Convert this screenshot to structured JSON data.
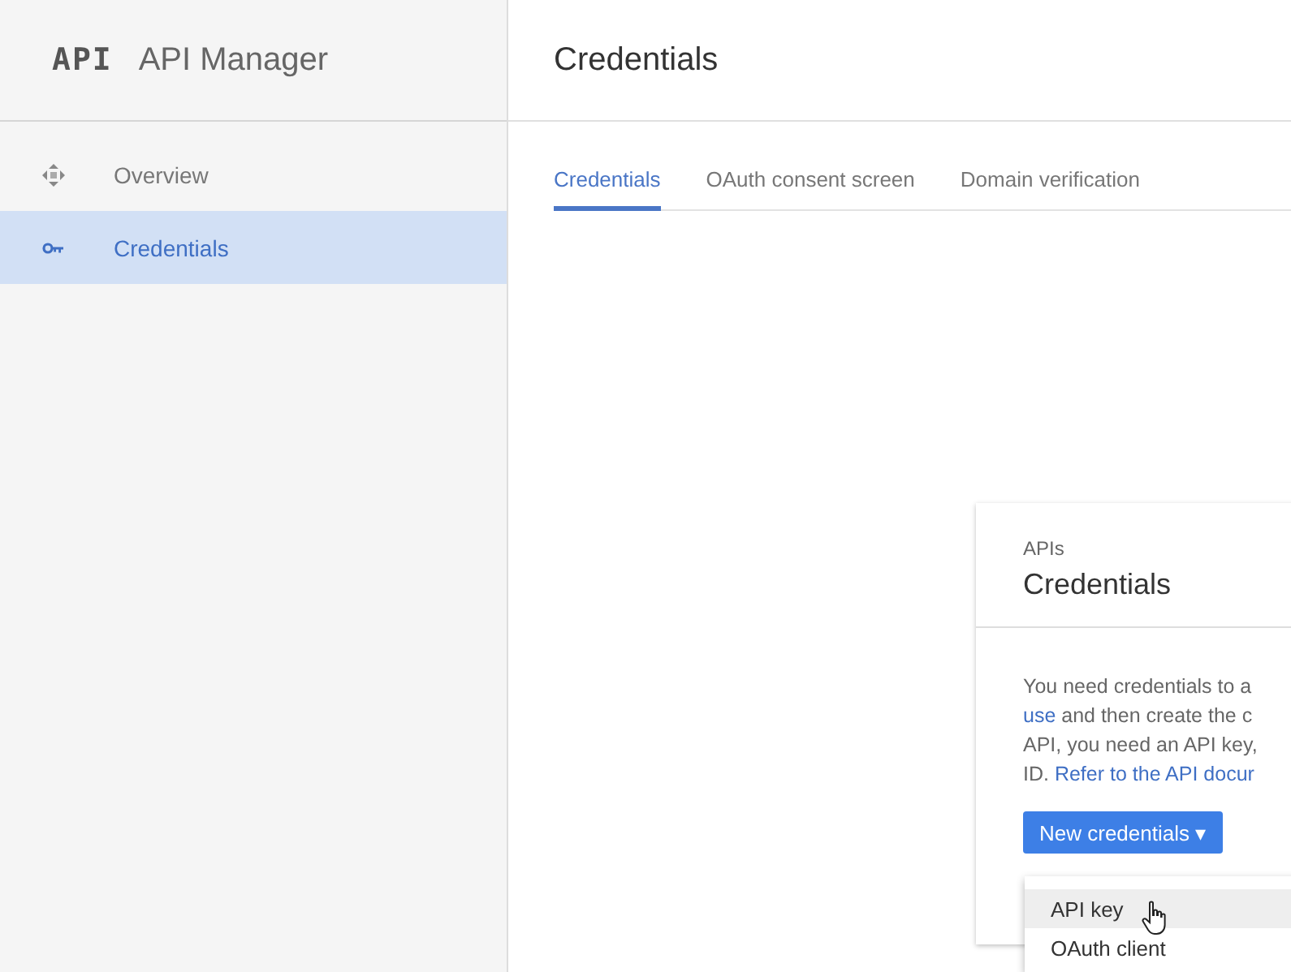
{
  "sidebar": {
    "logo": "API",
    "title": "API Manager",
    "items": [
      {
        "label": "Overview",
        "kind": "overview",
        "selected": false
      },
      {
        "label": "Credentials",
        "kind": "key",
        "selected": true
      }
    ]
  },
  "main": {
    "title": "Credentials",
    "tabs": [
      {
        "label": "Credentials",
        "selected": true
      },
      {
        "label": "OAuth consent screen",
        "selected": false
      },
      {
        "label": "Domain verification",
        "selected": false
      }
    ]
  },
  "card": {
    "overline": "APIs",
    "title": "Credentials",
    "lines": [
      [
        {
          "text": "You need credentials to a",
          "link": false
        }
      ],
      [
        {
          "text": "use",
          "link": true
        },
        {
          "text": " and then create the c",
          "link": false
        }
      ],
      [
        {
          "text": "API, you need an API key,",
          "link": false
        }
      ],
      [
        {
          "text": "ID. ",
          "link": false
        },
        {
          "text": "Refer to the API docur",
          "link": true
        }
      ]
    ],
    "button": "New credentials ▾",
    "menu": [
      {
        "label": "API key",
        "selected": true
      },
      {
        "label": "OAuth client",
        "selected": false
      }
    ]
  }
}
